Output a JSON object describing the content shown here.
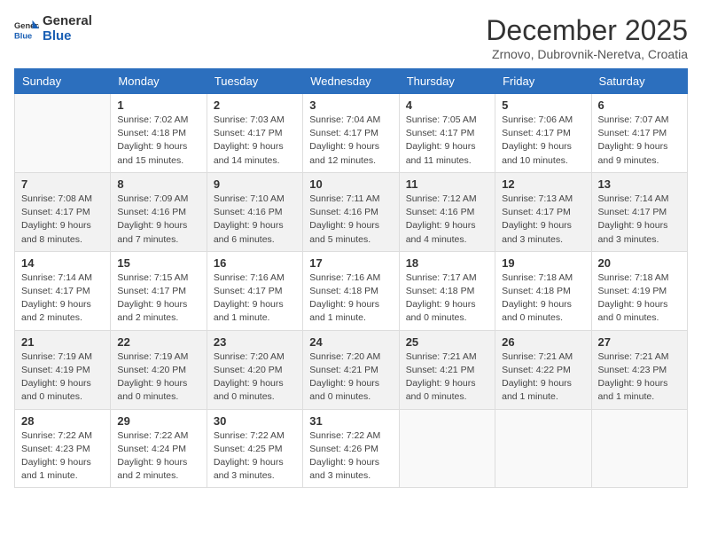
{
  "header": {
    "logo_line1": "General",
    "logo_line2": "Blue",
    "title": "December 2025",
    "subtitle": "Zrnovo, Dubrovnik-Neretva, Croatia"
  },
  "weekdays": [
    "Sunday",
    "Monday",
    "Tuesday",
    "Wednesday",
    "Thursday",
    "Friday",
    "Saturday"
  ],
  "weeks": [
    [
      {
        "day": "",
        "info": ""
      },
      {
        "day": "1",
        "info": "Sunrise: 7:02 AM\nSunset: 4:18 PM\nDaylight: 9 hours\nand 15 minutes."
      },
      {
        "day": "2",
        "info": "Sunrise: 7:03 AM\nSunset: 4:17 PM\nDaylight: 9 hours\nand 14 minutes."
      },
      {
        "day": "3",
        "info": "Sunrise: 7:04 AM\nSunset: 4:17 PM\nDaylight: 9 hours\nand 12 minutes."
      },
      {
        "day": "4",
        "info": "Sunrise: 7:05 AM\nSunset: 4:17 PM\nDaylight: 9 hours\nand 11 minutes."
      },
      {
        "day": "5",
        "info": "Sunrise: 7:06 AM\nSunset: 4:17 PM\nDaylight: 9 hours\nand 10 minutes."
      },
      {
        "day": "6",
        "info": "Sunrise: 7:07 AM\nSunset: 4:17 PM\nDaylight: 9 hours\nand 9 minutes."
      }
    ],
    [
      {
        "day": "7",
        "info": "Sunrise: 7:08 AM\nSunset: 4:17 PM\nDaylight: 9 hours\nand 8 minutes."
      },
      {
        "day": "8",
        "info": "Sunrise: 7:09 AM\nSunset: 4:16 PM\nDaylight: 9 hours\nand 7 minutes."
      },
      {
        "day": "9",
        "info": "Sunrise: 7:10 AM\nSunset: 4:16 PM\nDaylight: 9 hours\nand 6 minutes."
      },
      {
        "day": "10",
        "info": "Sunrise: 7:11 AM\nSunset: 4:16 PM\nDaylight: 9 hours\nand 5 minutes."
      },
      {
        "day": "11",
        "info": "Sunrise: 7:12 AM\nSunset: 4:16 PM\nDaylight: 9 hours\nand 4 minutes."
      },
      {
        "day": "12",
        "info": "Sunrise: 7:13 AM\nSunset: 4:17 PM\nDaylight: 9 hours\nand 3 minutes."
      },
      {
        "day": "13",
        "info": "Sunrise: 7:14 AM\nSunset: 4:17 PM\nDaylight: 9 hours\nand 3 minutes."
      }
    ],
    [
      {
        "day": "14",
        "info": "Sunrise: 7:14 AM\nSunset: 4:17 PM\nDaylight: 9 hours\nand 2 minutes."
      },
      {
        "day": "15",
        "info": "Sunrise: 7:15 AM\nSunset: 4:17 PM\nDaylight: 9 hours\nand 2 minutes."
      },
      {
        "day": "16",
        "info": "Sunrise: 7:16 AM\nSunset: 4:17 PM\nDaylight: 9 hours\nand 1 minute."
      },
      {
        "day": "17",
        "info": "Sunrise: 7:16 AM\nSunset: 4:18 PM\nDaylight: 9 hours\nand 1 minute."
      },
      {
        "day": "18",
        "info": "Sunrise: 7:17 AM\nSunset: 4:18 PM\nDaylight: 9 hours\nand 0 minutes."
      },
      {
        "day": "19",
        "info": "Sunrise: 7:18 AM\nSunset: 4:18 PM\nDaylight: 9 hours\nand 0 minutes."
      },
      {
        "day": "20",
        "info": "Sunrise: 7:18 AM\nSunset: 4:19 PM\nDaylight: 9 hours\nand 0 minutes."
      }
    ],
    [
      {
        "day": "21",
        "info": "Sunrise: 7:19 AM\nSunset: 4:19 PM\nDaylight: 9 hours\nand 0 minutes."
      },
      {
        "day": "22",
        "info": "Sunrise: 7:19 AM\nSunset: 4:20 PM\nDaylight: 9 hours\nand 0 minutes."
      },
      {
        "day": "23",
        "info": "Sunrise: 7:20 AM\nSunset: 4:20 PM\nDaylight: 9 hours\nand 0 minutes."
      },
      {
        "day": "24",
        "info": "Sunrise: 7:20 AM\nSunset: 4:21 PM\nDaylight: 9 hours\nand 0 minutes."
      },
      {
        "day": "25",
        "info": "Sunrise: 7:21 AM\nSunset: 4:21 PM\nDaylight: 9 hours\nand 0 minutes."
      },
      {
        "day": "26",
        "info": "Sunrise: 7:21 AM\nSunset: 4:22 PM\nDaylight: 9 hours\nand 1 minute."
      },
      {
        "day": "27",
        "info": "Sunrise: 7:21 AM\nSunset: 4:23 PM\nDaylight: 9 hours\nand 1 minute."
      }
    ],
    [
      {
        "day": "28",
        "info": "Sunrise: 7:22 AM\nSunset: 4:23 PM\nDaylight: 9 hours\nand 1 minute."
      },
      {
        "day": "29",
        "info": "Sunrise: 7:22 AM\nSunset: 4:24 PM\nDaylight: 9 hours\nand 2 minutes."
      },
      {
        "day": "30",
        "info": "Sunrise: 7:22 AM\nSunset: 4:25 PM\nDaylight: 9 hours\nand 3 minutes."
      },
      {
        "day": "31",
        "info": "Sunrise: 7:22 AM\nSunset: 4:26 PM\nDaylight: 9 hours\nand 3 minutes."
      },
      {
        "day": "",
        "info": ""
      },
      {
        "day": "",
        "info": ""
      },
      {
        "day": "",
        "info": ""
      }
    ]
  ]
}
